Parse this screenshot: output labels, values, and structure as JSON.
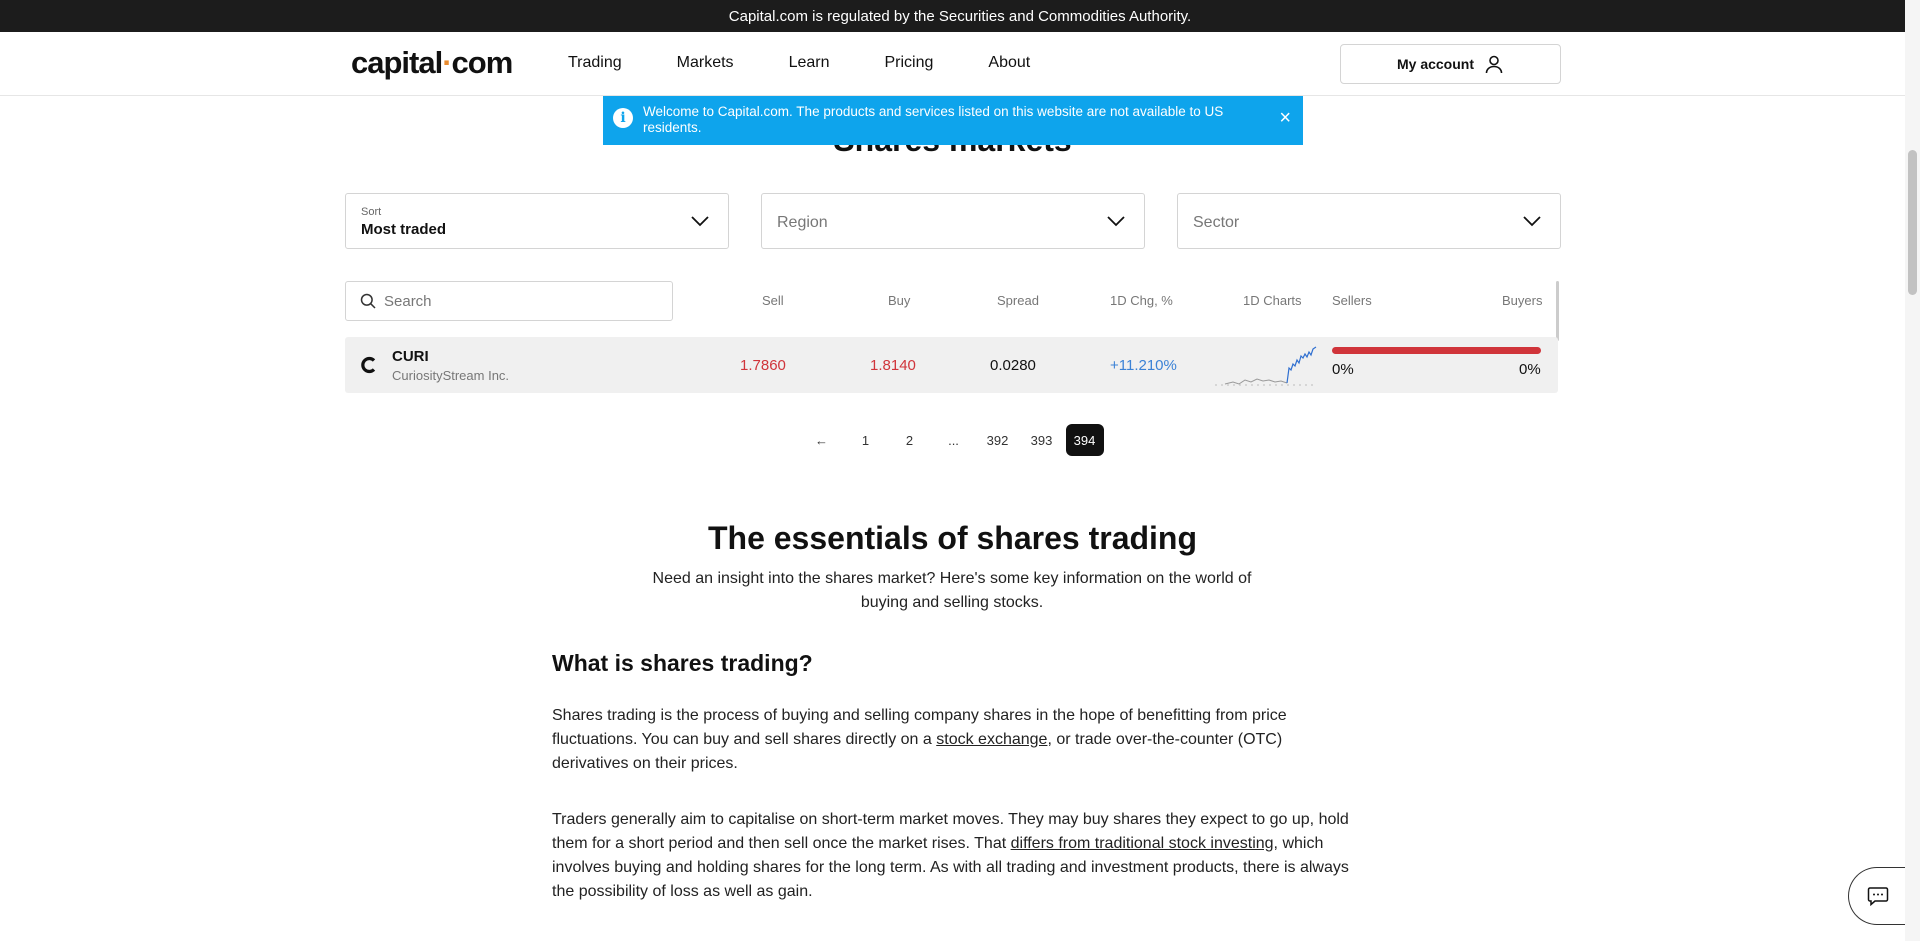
{
  "topbar": {
    "text": "Capital.com is regulated by the Securities and Commodities Authority."
  },
  "nav": {
    "logo_left": "capital",
    "logo_dot": "·",
    "logo_right": "com",
    "links": [
      "Trading",
      "Markets",
      "Learn",
      "Pricing",
      "About"
    ],
    "account_label": "My account"
  },
  "banner": {
    "text": "Welcome to Capital.com. The products and services listed on this website are not available to US residents.",
    "close": "×",
    "info": "i"
  },
  "section_title": "Shares markets",
  "filters": {
    "sort_label": "Sort",
    "sort_value": "Most traded",
    "region_placeholder": "Region",
    "sector_placeholder": "Sector"
  },
  "search": {
    "placeholder": "Search"
  },
  "table": {
    "headers": {
      "sell": "Sell",
      "buy": "Buy",
      "spread": "Spread",
      "change": "1D Chg, %",
      "charts": "1D Charts",
      "sellers": "Sellers",
      "buyers": "Buyers"
    },
    "rows": [
      {
        "symbol": "CURI",
        "name": "CuriosityStream Inc.",
        "sell": "1.7860",
        "buy": "1.8140",
        "spread": "0.0280",
        "change": "+11.210%",
        "sellers_pct": "0%",
        "buyers_pct": "0%"
      }
    ]
  },
  "pagination": {
    "prev": "←",
    "pages": [
      "1",
      "2",
      "...",
      "392",
      "393",
      "394"
    ],
    "current": "394"
  },
  "essentials": {
    "title": "The essentials of shares trading",
    "subtitle": "Need an insight into the shares market? Here's some key information on the world of buying and selling stocks.",
    "what_title": "What is shares trading?",
    "p1_a": "Shares trading is the process of buying and selling company shares in the hope of benefitting from price fluctuations. You can buy and sell shares directly on a ",
    "p1_link": "stock exchange",
    "p1_b": ", or trade over-the-counter (OTC) derivatives on their prices.",
    "p2_a": "Traders generally aim to capitalise on short-term market moves. They may buy shares they expect to go up, hold them for a short period and then sell once the market rises. That ",
    "p2_link": "differs from traditional stock investing",
    "p2_b": ", which involves buying and holding shares for the long term. As with all trading and investment products, there is always the possibility of loss as well as gain."
  },
  "colors": {
    "accent_blue": "#0ea4ec",
    "sell_red": "#d0343a",
    "change_blue": "#3b82d6",
    "logo_dot": "#e88b2e"
  }
}
